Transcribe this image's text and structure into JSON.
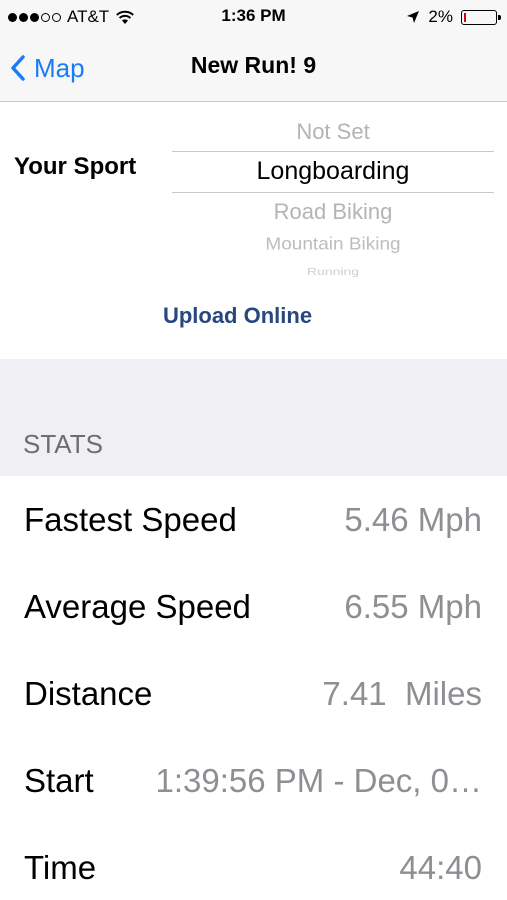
{
  "status_bar": {
    "carrier": "AT&T",
    "time": "1:36 PM",
    "battery": "2%",
    "signal_full": 3,
    "signal_total": 5
  },
  "nav": {
    "back_label": "Map",
    "title": "New Run! 9",
    "tint_color": "#1a7cf5"
  },
  "sport": {
    "label": "Your Sport",
    "options": [
      "Not Set",
      "Longboarding",
      "Road Biking",
      "Mountain Biking",
      "Running"
    ],
    "selected": "Longboarding",
    "upload_label": "Upload Online"
  },
  "stats": {
    "header": "STATS",
    "rows": [
      {
        "label": "Fastest Speed",
        "value": "5.46 Mph"
      },
      {
        "label": "Average Speed",
        "value": "6.55 Mph"
      },
      {
        "label": "Distance",
        "value": "7.41  Miles"
      },
      {
        "label": "Start",
        "value": "1:39:56 PM - Dec, 0…"
      },
      {
        "label": "Time",
        "value": "44:40"
      }
    ]
  }
}
